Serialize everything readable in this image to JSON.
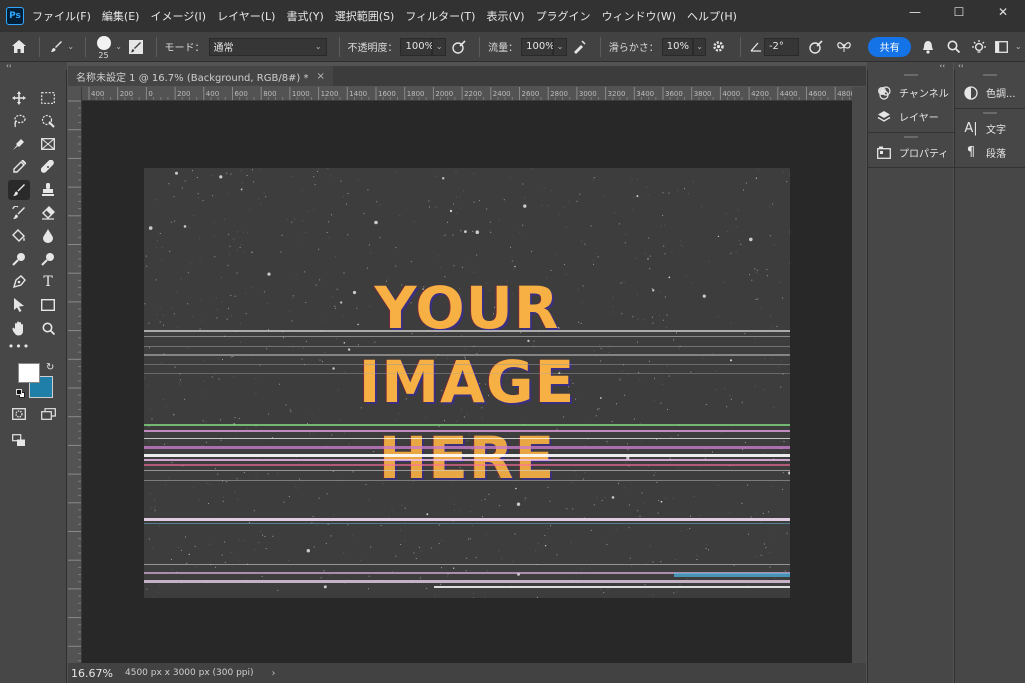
{
  "app": {
    "logo": "Ps",
    "menu": [
      "ファイル(F)",
      "編集(E)",
      "イメージ(I)",
      "レイヤー(L)",
      "書式(Y)",
      "選択範囲(S)",
      "フィルター(T)",
      "表示(V)",
      "プラグイン",
      "ウィンドウ(W)",
      "ヘルプ(H)"
    ],
    "window_controls": {
      "minimize": "—",
      "maximize": "☐",
      "close": "✕"
    }
  },
  "options": {
    "brush_size": "25",
    "mode_label": "モード：",
    "mode_value": "通常",
    "opacity_label": "不透明度：",
    "opacity_value": "100%",
    "flow_label": "流量：",
    "flow_value": "100%",
    "smoothing_label": "滑らかさ：",
    "smoothing_value": "10%",
    "angle_value": "-2°",
    "share_label": "共有"
  },
  "document": {
    "tab_title": "名称未設定 1 @ 16.7% (Background, RGB/8#) *",
    "tab_close": "×",
    "headline_lines": [
      "YOUR",
      "IMAGE",
      "HERE"
    ],
    "ruler_h_ticks": [
      "400",
      "200",
      "0",
      "200",
      "400",
      "600",
      "800",
      "1000",
      "1200",
      "1400",
      "1600",
      "1800",
      "2000",
      "2200",
      "2400",
      "2600",
      "2800",
      "3000",
      "3200",
      "3400",
      "3600",
      "3800",
      "4000",
      "4200",
      "4400",
      "4600",
      "4800"
    ]
  },
  "status": {
    "zoom": "16.67%",
    "doc_size": "4500 px x 3000 px (300 ppi)",
    "arrow": "›"
  },
  "panels": {
    "collapse_arrows": "‹‹",
    "group1": [
      {
        "icon": "channels-icon",
        "label": "チャンネル"
      },
      {
        "icon": "layers-icon",
        "label": "レイヤー"
      },
      {
        "icon": "properties-icon",
        "label": "プロパティ"
      }
    ],
    "group2": [
      {
        "icon": "adjustments-icon",
        "label": "色調..."
      },
      {
        "icon": "character-icon",
        "label": "文字"
      },
      {
        "icon": "paragraph-icon",
        "label": "段落"
      }
    ]
  },
  "colors": {
    "foreground": "#ffffff",
    "background": "#1f7fa8",
    "accent": "#1473e6",
    "headline": "#f7b043"
  }
}
